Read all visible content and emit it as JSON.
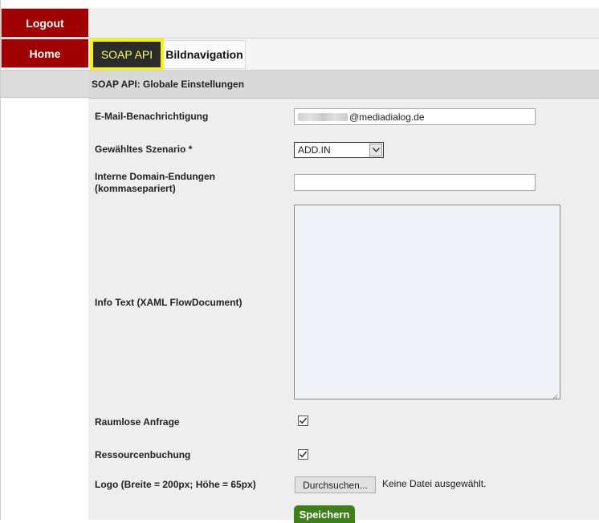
{
  "nav": {
    "logout_label": "Logout",
    "home_label": "Home"
  },
  "tabs": [
    {
      "label": "SOAP API",
      "active": true
    },
    {
      "label": "Bildnavigation",
      "active": false
    }
  ],
  "panel": {
    "title": "SOAP API: Globale Einstellungen"
  },
  "form": {
    "email": {
      "label": "E-Mail-Benachrichtigung",
      "value_visible": "@mediadialog.de"
    },
    "scenario": {
      "label": "Gewähltes Szenario *",
      "selected": "ADD.IN"
    },
    "domains": {
      "label_line1": "Interne Domain-Endungen",
      "label_line2": "(kommasepariert)",
      "value": ""
    },
    "info": {
      "label": "Info Text (XAML FlowDocument)",
      "value": ""
    },
    "raumlose": {
      "label": "Raumlose Anfrage",
      "checked": true
    },
    "ressourcen": {
      "label": "Ressourcenbuchung",
      "checked": true
    },
    "logo": {
      "label": "Logo (Breite = 200px; Höhe = 65px)",
      "button_label": "Durchsuchen...",
      "status": "Keine Datei ausgewählt."
    },
    "save_label": "Speichern"
  },
  "colors": {
    "nav_red": "#a00000",
    "tab_active_bg": "#2b2b2b",
    "tab_active_text": "#ffff66",
    "tab_highlight": "#f5f500",
    "save_green": "#3f7f1a"
  },
  "icons": {
    "select_arrow": "chevron-down-icon",
    "checkbox_mark": "check-icon",
    "textarea_resize": "resize-grip-icon"
  }
}
